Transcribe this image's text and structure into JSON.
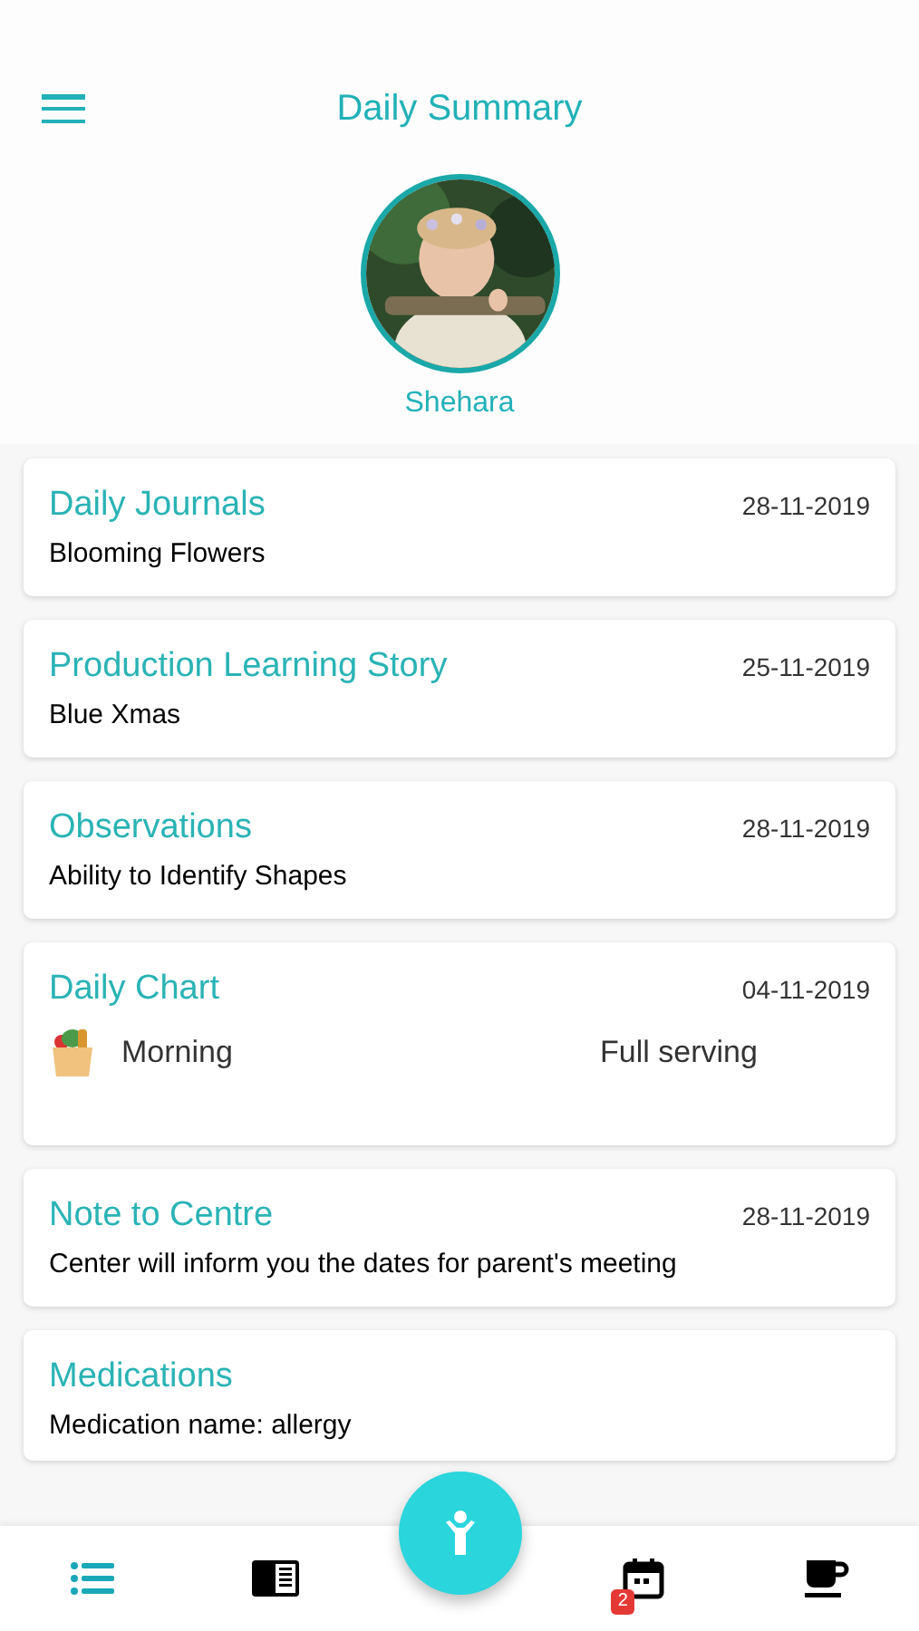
{
  "header": {
    "title": "Daily Summary"
  },
  "child": {
    "name": "Shehara"
  },
  "cards": [
    {
      "kind": "entry",
      "title": "Daily Journals",
      "date": "28-11-2019",
      "text": "Blooming Flowers"
    },
    {
      "kind": "entry",
      "title": "Production Learning Story",
      "date": "25-11-2019",
      "text": "Blue Xmas"
    },
    {
      "kind": "entry",
      "title": "Observations",
      "date": "28-11-2019",
      "text": "Ability to Identify Shapes"
    },
    {
      "kind": "chart",
      "title": "Daily Chart",
      "date": "04-11-2019",
      "meal": "Morning",
      "serving": "Full serving"
    },
    {
      "kind": "entry",
      "title": "Note to Centre",
      "date": "28-11-2019",
      "text": "Center will inform you the dates for parent's meeting"
    },
    {
      "kind": "med",
      "title": "Medications",
      "text": "Medication name: allergy"
    }
  ],
  "nav": [
    {
      "kind": "list",
      "selected": true
    },
    {
      "kind": "book",
      "selected": false
    },
    {
      "kind": "fab",
      "selected": false
    },
    {
      "kind": "calendar",
      "selected": false,
      "badge": "2"
    },
    {
      "kind": "cup",
      "selected": false
    }
  ]
}
